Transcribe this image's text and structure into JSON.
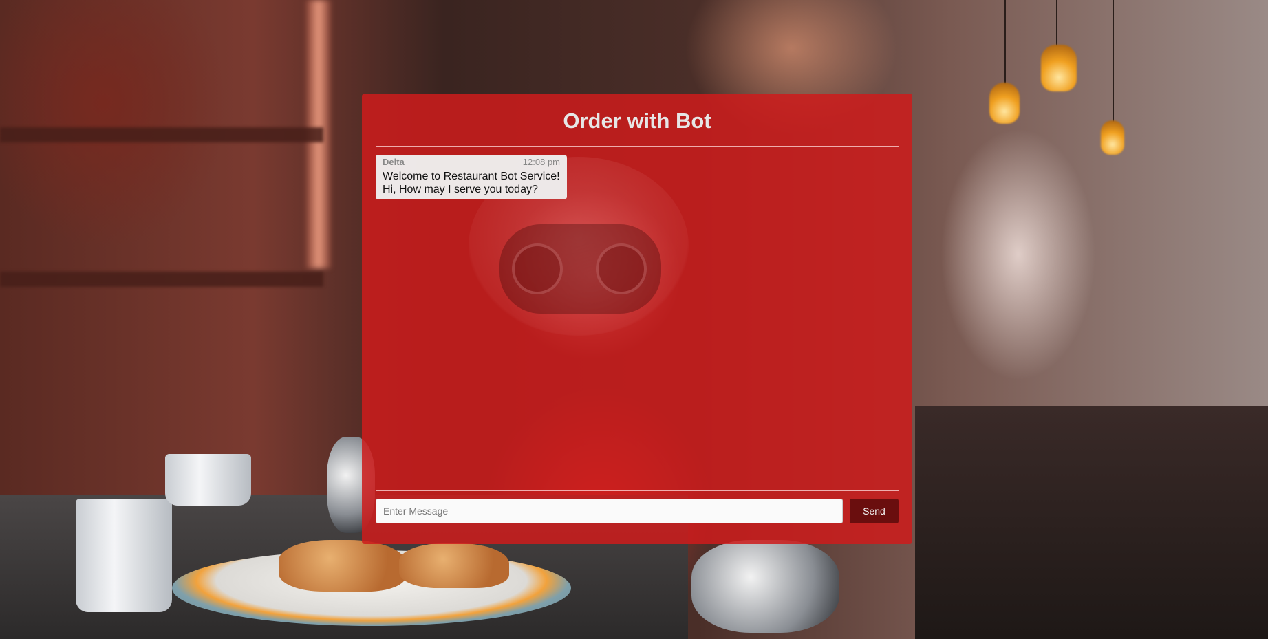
{
  "chat": {
    "title": "Order with Bot",
    "messages": [
      {
        "sender": "Delta",
        "time": "12:08 pm",
        "lines": [
          "Welcome to Restaurant Bot Service!",
          "Hi, How may I serve you today?"
        ]
      }
    ],
    "input": {
      "placeholder": "Enter Message",
      "value": ""
    },
    "send_label": "Send"
  },
  "colors": {
    "panel": "#cd1c1c",
    "send_button": "#6a0e0e",
    "title_text": "#e6e6e6",
    "bubble": "#eeeeee"
  },
  "icons": {
    "background": "restaurant-robot-photo"
  }
}
